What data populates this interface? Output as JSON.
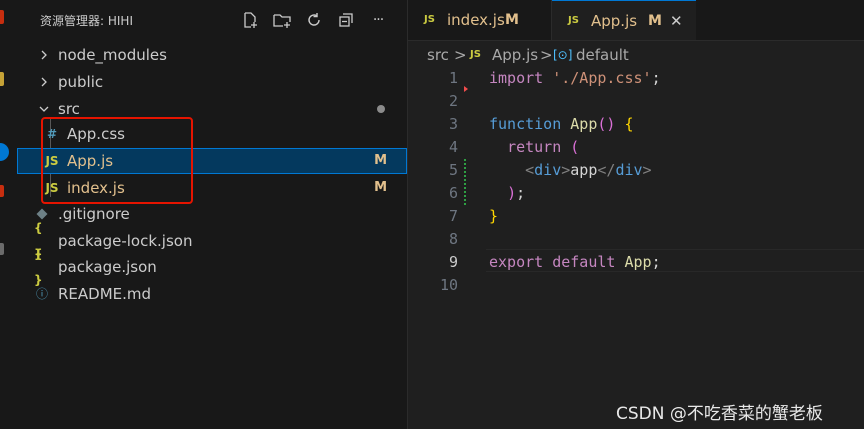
{
  "explorer": {
    "title": "资源管理器: HIHI",
    "actions": [
      {
        "icon": "new-file-icon"
      },
      {
        "icon": "new-folder-icon"
      },
      {
        "icon": "refresh-icon"
      },
      {
        "icon": "collapse-all-icon"
      },
      {
        "icon": "more-icon",
        "glyph": "···"
      }
    ],
    "tree": [
      {
        "label": "node_modules",
        "type": "folder",
        "expanded": false
      },
      {
        "label": "public",
        "type": "folder",
        "expanded": false
      },
      {
        "label": "src",
        "type": "folder",
        "expanded": true,
        "modified_dot": true
      },
      {
        "label": "App.css",
        "type": "css",
        "icon_text": "#"
      },
      {
        "label": "App.js",
        "type": "js",
        "icon_text": "JS",
        "badge": "M",
        "selected": true
      },
      {
        "label": "index.js",
        "type": "js",
        "icon_text": "JS",
        "badge": "M"
      },
      {
        "label": ".gitignore",
        "type": "git"
      },
      {
        "label": "package-lock.json",
        "type": "json",
        "icon_text": "{ }"
      },
      {
        "label": "package.json",
        "type": "json",
        "icon_text": "{ }"
      },
      {
        "label": "README.md",
        "type": "info",
        "icon_text": "ⓘ"
      }
    ]
  },
  "tabs": [
    {
      "label": "index.js",
      "icon_text": "JS",
      "badge": "M",
      "active": false
    },
    {
      "label": "App.js",
      "icon_text": "JS",
      "badge": "M",
      "active": true,
      "close": "✕"
    }
  ],
  "breadcrumb": {
    "folder": "src",
    "sep": ">",
    "file_icon": "JS",
    "file": "App.js",
    "symbol_icon": "[⊙]",
    "symbol": "default"
  },
  "code": {
    "line_numbers": [
      "1",
      "2",
      "3",
      "4",
      "5",
      "6",
      "7",
      "8",
      "9",
      "10"
    ],
    "current_line": "9",
    "l1": {
      "kw": "import",
      "str": "'./App.css'",
      "semi": ";"
    },
    "l3": {
      "kw": "function",
      "fn": "App",
      "paren": "()",
      "brace": "{"
    },
    "l4": {
      "kw": "return",
      "paren": "("
    },
    "l5": {
      "open_lt": "<",
      "tag1": "div",
      "open_gt": ">",
      "text": "app",
      "close_lt": "</",
      "tag2": "div",
      "close_gt": ">"
    },
    "l6": {
      "paren": ")",
      "semi": ";"
    },
    "l7": {
      "brace": "}"
    },
    "l9": {
      "kw1": "export",
      "kw2": "default",
      "id": "App",
      "semi": ";"
    }
  },
  "watermark": "CSDN @不吃香菜的蟹老板",
  "colors": {
    "accent": "#0078d4",
    "highlight_box": "#e51400",
    "modified": "#e2c08d",
    "js_icon": "#cbcb41"
  }
}
